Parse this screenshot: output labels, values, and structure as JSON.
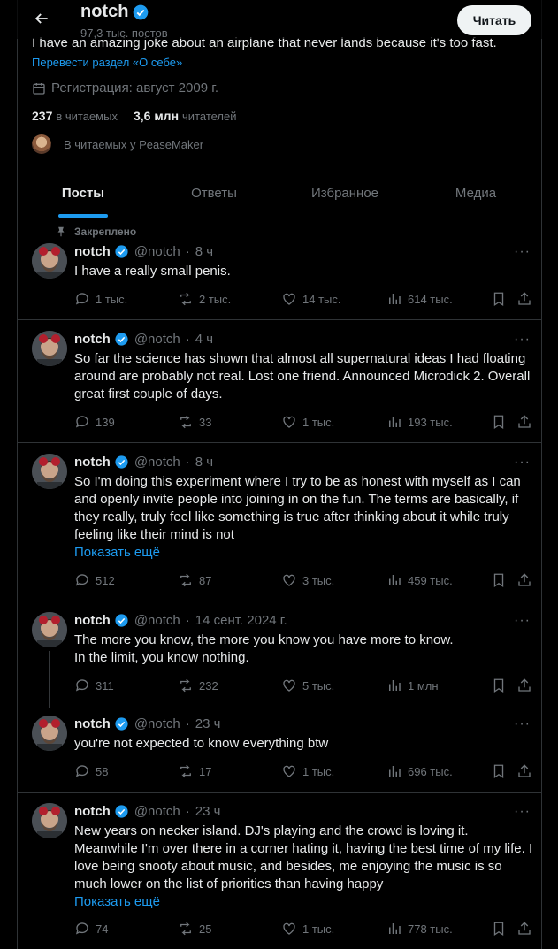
{
  "header": {
    "name": "notch",
    "posts_count": "97,3 тыс. постов",
    "follow_label": "Читать"
  },
  "profile": {
    "bio": "I have an amazing joke about an airplane that never lands because it's too fast.",
    "translate_bio": "Перевести раздел «О себе»",
    "joined": "Регистрация: август 2009 г.",
    "following_count": "237",
    "following_label": "в читаемых",
    "followers_count": "3,6 млн",
    "followers_label": "читателей",
    "followed_by": "В читаемых у PeaseMaker"
  },
  "tabs": [
    "Посты",
    "Ответы",
    "Избранное",
    "Медиа"
  ],
  "pinned_label": "Закреплено",
  "posts": [
    {
      "name": "notch",
      "handle": "@notch",
      "time": "8 ч",
      "text": "I have a really small penis.",
      "replies": "1 тыс.",
      "reposts": "2 тыс.",
      "likes": "14 тыс.",
      "views": "614 тыс."
    },
    {
      "name": "notch",
      "handle": "@notch",
      "time": "4 ч",
      "text": "So far the science has shown that almost all supernatural ideas I had floating around are probably not real. Lost one friend. Announced Microdick 2. Overall great first couple of days.",
      "replies": "139",
      "reposts": "33",
      "likes": "1 тыс.",
      "views": "193 тыс."
    },
    {
      "name": "notch",
      "handle": "@notch",
      "time": "8 ч",
      "text": "So I'm doing this experiment where I try to be as honest with myself as I can and openly invite people into joining in on the fun. The terms are basically, if they really, truly feel like something is true after thinking about it while truly feeling like their mind is not",
      "show_more": "Показать ещё",
      "replies": "512",
      "reposts": "87",
      "likes": "3 тыс.",
      "views": "459 тыс."
    },
    {
      "name": "notch",
      "handle": "@notch",
      "time": "14 сент. 2024 г.",
      "text": "The more you know, the more you know you have more to know.\nIn the limit, you know nothing.",
      "replies": "311",
      "reposts": "232",
      "likes": "5 тыс.",
      "views": "1 млн"
    },
    {
      "name": "notch",
      "handle": "@notch",
      "time": "23 ч",
      "text": "you're not expected to know everything btw",
      "replies": "58",
      "reposts": "17",
      "likes": "1 тыс.",
      "views": "696 тыс."
    },
    {
      "name": "notch",
      "handle": "@notch",
      "time": "23 ч",
      "text": "New years on necker island. DJ's playing and the crowd is loving it. Meanwhile I'm over there in a corner hating it, having the best time of my life. I love being snooty about music, and besides, me enjoying the music is so much lower on the list of priorities than having happy",
      "show_more": "Показать ещё",
      "replies": "74",
      "reposts": "25",
      "likes": "1 тыс.",
      "views": "778 тыс."
    }
  ],
  "colors": {
    "accent": "#1d9bf0",
    "muted": "#71767b",
    "text": "#e7e9ea",
    "border": "#2f3336"
  },
  "icons": [
    "back-arrow-icon",
    "verified-icon",
    "calendar-icon",
    "pin-icon",
    "more-icon",
    "reply-icon",
    "repost-icon",
    "like-icon",
    "views-icon",
    "bookmark-icon",
    "share-icon"
  ]
}
